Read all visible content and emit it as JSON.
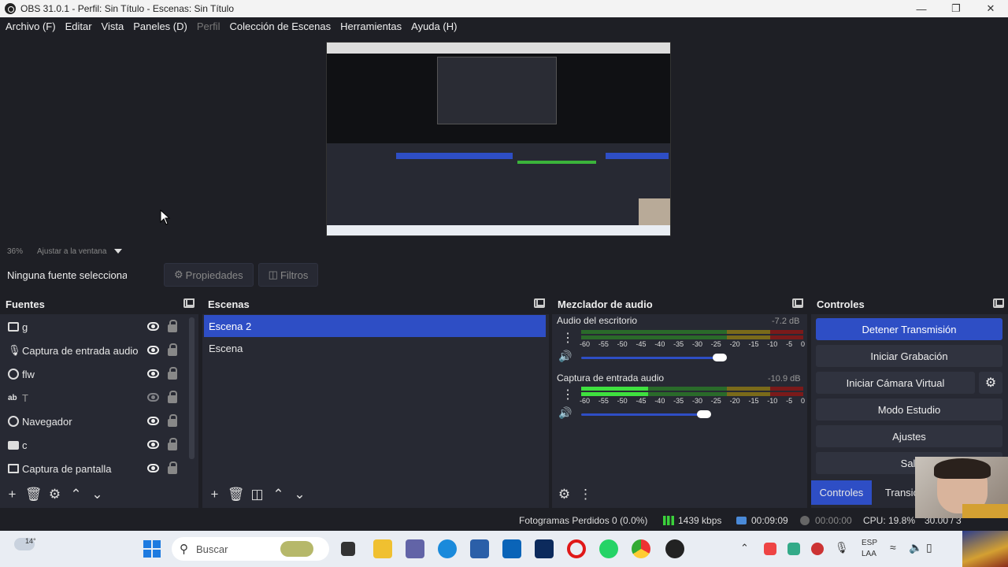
{
  "window": {
    "title": "OBS 31.0.1 - Perfil: Sin Título - Escenas: Sin Título"
  },
  "menu": [
    {
      "label": "Archivo (F)",
      "enabled": true
    },
    {
      "label": "Editar",
      "enabled": true
    },
    {
      "label": "Vista",
      "enabled": true
    },
    {
      "label": "Paneles (D)",
      "enabled": true
    },
    {
      "label": "Perfil",
      "enabled": false
    },
    {
      "label": "Colección de Escenas",
      "enabled": true
    },
    {
      "label": "Herramientas",
      "enabled": true
    },
    {
      "label": "Ayuda (H)",
      "enabled": true
    }
  ],
  "preview": {
    "zoom": "36%",
    "fit_label": "Ajustar a la ventana"
  },
  "source_toolbar": {
    "no_source": "Ninguna fuente seleccionada",
    "properties": "Propiedades",
    "filters": "Filtros"
  },
  "sources": {
    "title": "Fuentes",
    "items": [
      {
        "name": "g",
        "icon": "image-icon",
        "visible": true
      },
      {
        "name": "Captura de entrada audio",
        "icon": "microphone-icon",
        "visible": true
      },
      {
        "name": "flw",
        "icon": "browser-icon",
        "visible": true
      },
      {
        "name": "T",
        "icon": "text-icon",
        "visible": false
      },
      {
        "name": "Navegador",
        "icon": "browser-icon",
        "visible": true
      },
      {
        "name": "c",
        "icon": "camera-icon",
        "visible": true
      },
      {
        "name": "Captura de pantalla",
        "icon": "monitor-icon",
        "visible": true
      }
    ]
  },
  "scenes": {
    "title": "Escenas",
    "items": [
      {
        "name": "Escena 2",
        "selected": true
      },
      {
        "name": "Escena",
        "selected": false
      }
    ]
  },
  "mixer": {
    "title": "Mezclador de audio",
    "channels": [
      {
        "name": "Audio del escritorio",
        "db": "-7.2 dB",
        "level": 0.0,
        "volume": 0.88
      },
      {
        "name": "Captura de entrada audio",
        "db": "-10.9 dB",
        "level": 0.3,
        "volume": 0.78
      }
    ],
    "ticks": [
      "-60",
      "-55",
      "-50",
      "-45",
      "-40",
      "-35",
      "-30",
      "-25",
      "-20",
      "-15",
      "-10",
      "-5",
      "0"
    ]
  },
  "controls": {
    "title": "Controles",
    "buttons": [
      "Detener Transmisión",
      "Iniciar Grabación",
      "Iniciar Cámara Virtual",
      "Modo Estudio",
      "Ajustes",
      "Sali"
    ],
    "tabs": [
      "Controles",
      "Transic"
    ]
  },
  "status": {
    "dropped": "Fotogramas Perdidos 0 (0.0%)",
    "bitrate": "1439 kbps",
    "stream_time": "00:09:09",
    "rec_time": "00:00:00",
    "cpu": "CPU: 19.8%",
    "fps": "30.00 / 3"
  },
  "taskbar": {
    "search": "Buscar",
    "weather": "14°",
    "lang": "ESP",
    "lang2": "LAA"
  },
  "colors": {
    "accent": "#2e4ec5",
    "panel": "#272933",
    "bg": "#1e1f25"
  }
}
